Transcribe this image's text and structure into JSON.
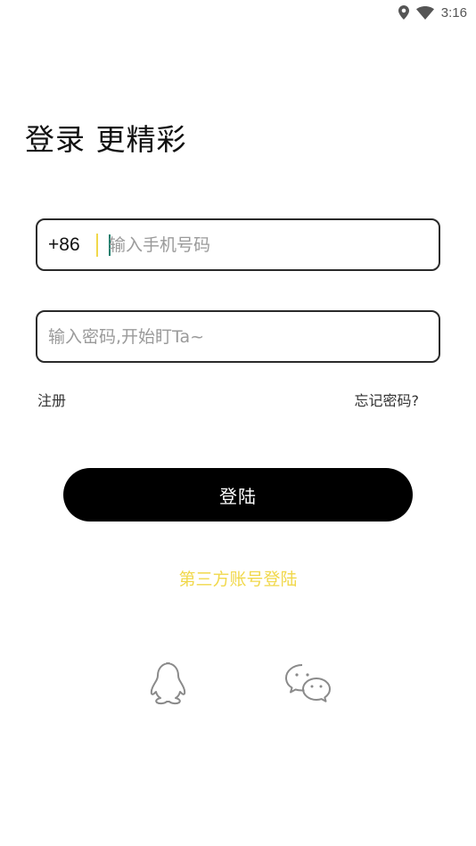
{
  "status_bar": {
    "time": "3:16",
    "icons": [
      "location-icon",
      "wifi-icon"
    ]
  },
  "page": {
    "title": "登录 更精彩"
  },
  "phone_field": {
    "country_code": "+86",
    "placeholder": "输入手机号码",
    "value": ""
  },
  "password_field": {
    "placeholder": "输入密码,开始盯Ta~",
    "value": ""
  },
  "links": {
    "register": "注册",
    "forgot_password": "忘记密码?"
  },
  "login_button": {
    "label": "登陆"
  },
  "third_party": {
    "label": "第三方账号登陆",
    "icons": [
      "qq-icon",
      "wechat-icon"
    ]
  },
  "colors": {
    "accent": "#f1d84b",
    "button": "#000000",
    "border": "#2a2a2a",
    "placeholder": "#9a9a9a",
    "caret": "#1a7f6d"
  }
}
